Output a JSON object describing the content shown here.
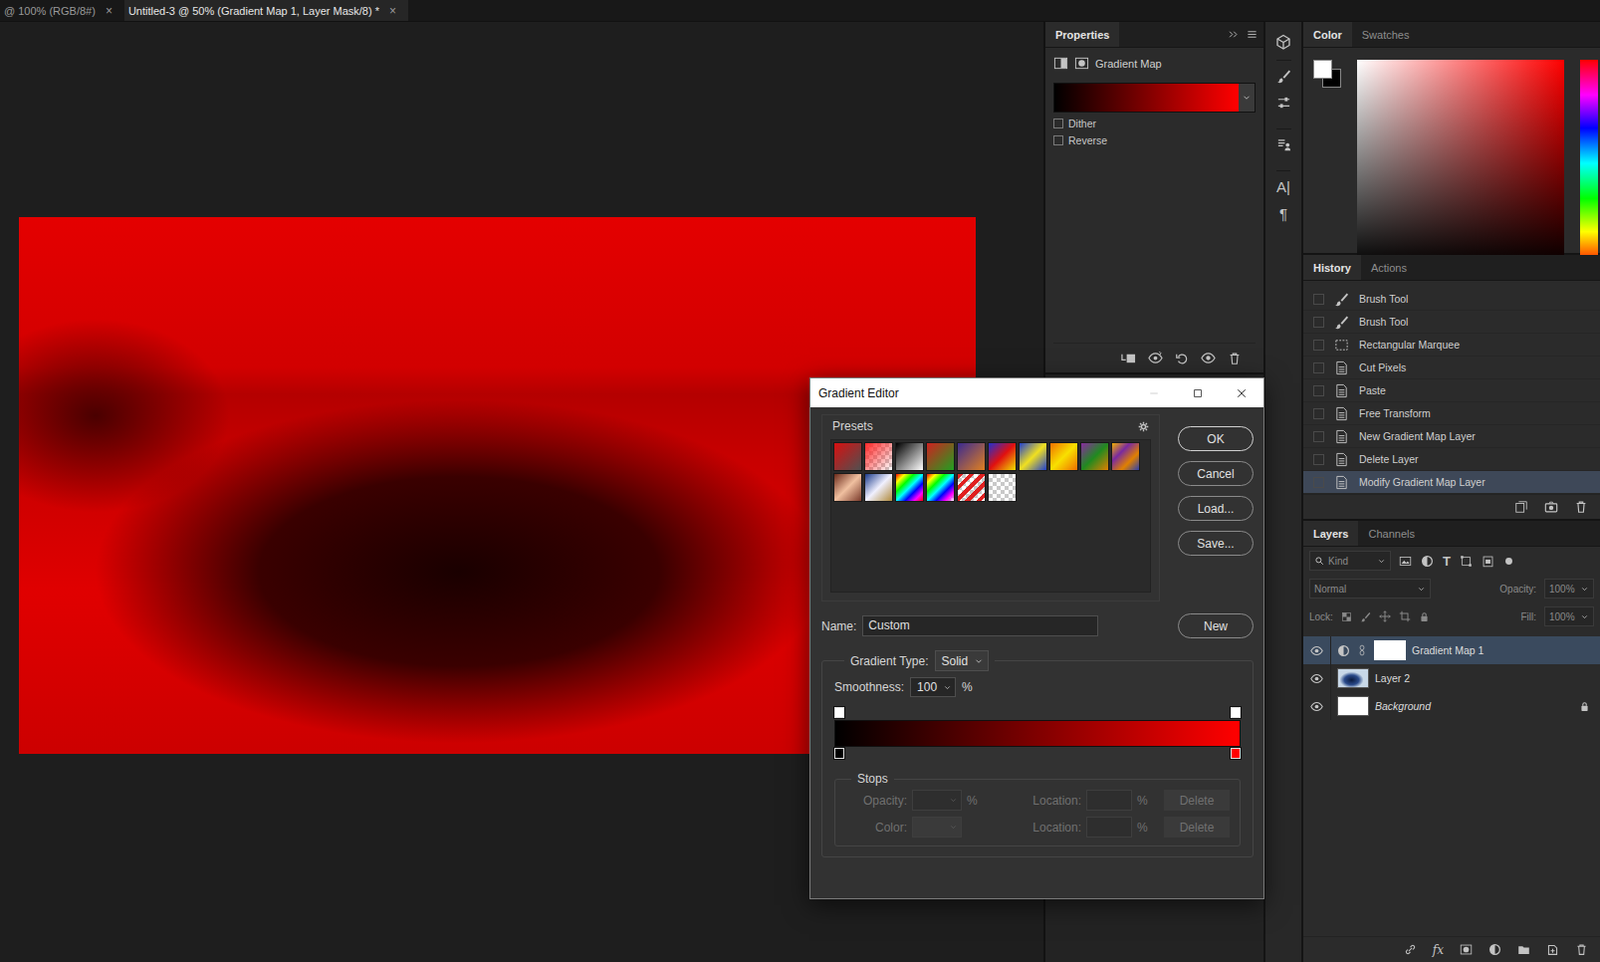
{
  "document_tabs": [
    {
      "label": "@ 100% (RGB/8#)",
      "close": "×",
      "selected": false
    },
    {
      "label": "Untitled-3 @ 50% (Gradient Map 1, Layer Mask/8) *",
      "close": "×",
      "selected": true
    }
  ],
  "gradient": {
    "colors": [
      "#000000",
      "#ff0000"
    ]
  },
  "properties": {
    "tab": "Properties",
    "adjustment": "Gradient Map",
    "options": [
      {
        "label": "Dither",
        "checked": false
      },
      {
        "label": "Reverse",
        "checked": false
      }
    ]
  },
  "panel_strip": {
    "glyphs": [
      "A|",
      "¶"
    ]
  },
  "color_panel": {
    "tabs": [
      {
        "label": "Color",
        "selected": true
      },
      {
        "label": "Swatches",
        "selected": false
      }
    ],
    "foreground": "#ffffff",
    "background": "#000000",
    "hue": "#ff0000"
  },
  "history": {
    "tabs": [
      {
        "label": "History",
        "selected": true
      },
      {
        "label": "Actions",
        "selected": false
      }
    ],
    "items": [
      {
        "label": "Brush Tool",
        "kind": "brush",
        "selected": false
      },
      {
        "label": "Brush Tool",
        "kind": "brush",
        "selected": false
      },
      {
        "label": "Rectangular Marquee",
        "kind": "marquee",
        "selected": false
      },
      {
        "label": "Cut Pixels",
        "kind": "step",
        "selected": false
      },
      {
        "label": "Paste",
        "kind": "step",
        "selected": false
      },
      {
        "label": "Free Transform",
        "kind": "step",
        "selected": false
      },
      {
        "label": "New Gradient Map Layer",
        "kind": "step",
        "selected": false
      },
      {
        "label": "Delete Layer",
        "kind": "step",
        "selected": false
      },
      {
        "label": "Modify Gradient Map Layer",
        "kind": "step",
        "selected": true
      }
    ]
  },
  "layers": {
    "tabs": [
      {
        "label": "Layers",
        "selected": true
      },
      {
        "label": "Channels",
        "selected": false
      }
    ],
    "filter": "Kind",
    "type_glyph": "T",
    "blend_mode": "Normal",
    "opacity_label": "Opacity:",
    "opacity": "100%",
    "lock_label": "Lock:",
    "fill_label": "Fill:",
    "fill": "100%",
    "fx": "fx",
    "items": [
      {
        "name": "Gradient Map 1",
        "kind": "adjustment",
        "visible": true,
        "selected": true,
        "locked": false
      },
      {
        "name": "Layer 2",
        "kind": "image",
        "visible": true,
        "selected": false,
        "locked": false
      },
      {
        "name": "Background",
        "kind": "background",
        "visible": true,
        "selected": false,
        "locked": true
      }
    ]
  },
  "gradient_editor": {
    "title": "Gradient Editor",
    "presets_label": "Presets",
    "presets": [
      {
        "kind": "solid",
        "colors": [
          "#d81010",
          "#505050"
        ]
      },
      {
        "kind": "fade",
        "colors": [
          "#ff2a2a"
        ]
      },
      {
        "kind": "solid",
        "colors": [
          "#000000",
          "#ffffff"
        ]
      },
      {
        "kind": "solid",
        "colors": [
          "#d02020",
          "#20a020"
        ]
      },
      {
        "kind": "solid",
        "colors": [
          "#3a2a90",
          "#e08020"
        ]
      },
      {
        "kind": "solid",
        "colors": [
          "#2030d0",
          "#e01010",
          "#f0e000"
        ]
      },
      {
        "kind": "solid",
        "colors": [
          "#2040d0",
          "#f0e020",
          "#2040d0"
        ]
      },
      {
        "kind": "solid",
        "colors": [
          "#f07000",
          "#f8e000",
          "#f07000"
        ]
      },
      {
        "kind": "solid",
        "colors": [
          "#8a2aa0",
          "#208a20",
          "#e08000"
        ]
      },
      {
        "kind": "solid",
        "colors": [
          "#f0b000",
          "#7a2aa0",
          "#e08000",
          "#2a40b0"
        ]
      },
      {
        "kind": "solid",
        "colors": [
          "#6a2a1a",
          "#f0c0a0",
          "#7a3a2a"
        ]
      },
      {
        "kind": "solid",
        "colors": [
          "#1a3a8a",
          "#f0f0ff",
          "#b08a3a"
        ]
      },
      {
        "kind": "solid",
        "colors": [
          "#ff0000",
          "#ffff00",
          "#00ff00",
          "#00ffff",
          "#0000ff",
          "#ff00ff",
          "#ff0000"
        ]
      },
      {
        "kind": "fade",
        "colors": [
          "#ff0000",
          "#ffff00",
          "#00ff00",
          "#00ffff",
          "#0000ff",
          "#ff00ff"
        ]
      },
      {
        "kind": "stripes",
        "colors": [
          "#e02020"
        ]
      },
      {
        "kind": "fade",
        "colors": []
      }
    ],
    "buttons": [
      {
        "label": "OK",
        "default": true
      },
      {
        "label": "Cancel",
        "default": false
      },
      {
        "label": "Load...",
        "default": false
      },
      {
        "label": "Save...",
        "default": false
      }
    ],
    "name_label": "Name:",
    "name": "Custom",
    "new_button": "New",
    "gradient_type_label": "Gradient Type:",
    "gradient_type": "Solid",
    "smoothness_label": "Smoothness:",
    "smoothness": "100",
    "smoothness_unit": "%",
    "opacity_stops": [
      {
        "location": 0,
        "selected": false
      },
      {
        "location": 1,
        "selected": false
      }
    ],
    "color_stops": [
      {
        "location": 0,
        "color": "#000000",
        "selected": false
      },
      {
        "location": 1,
        "color": "#ff0000",
        "selected": false
      }
    ],
    "stops_label": "Stops",
    "stop_fields": [
      {
        "kind": "opacity",
        "label": "Opacity:",
        "value": "",
        "unit": "%",
        "location_label": "Location:",
        "location": "",
        "location_unit": "%",
        "delete": "Delete",
        "disabled": true
      },
      {
        "kind": "color",
        "label": "Color:",
        "value": "",
        "unit": "",
        "location_label": "Location:",
        "location": "",
        "location_unit": "%",
        "delete": "Delete",
        "disabled": true
      }
    ]
  }
}
